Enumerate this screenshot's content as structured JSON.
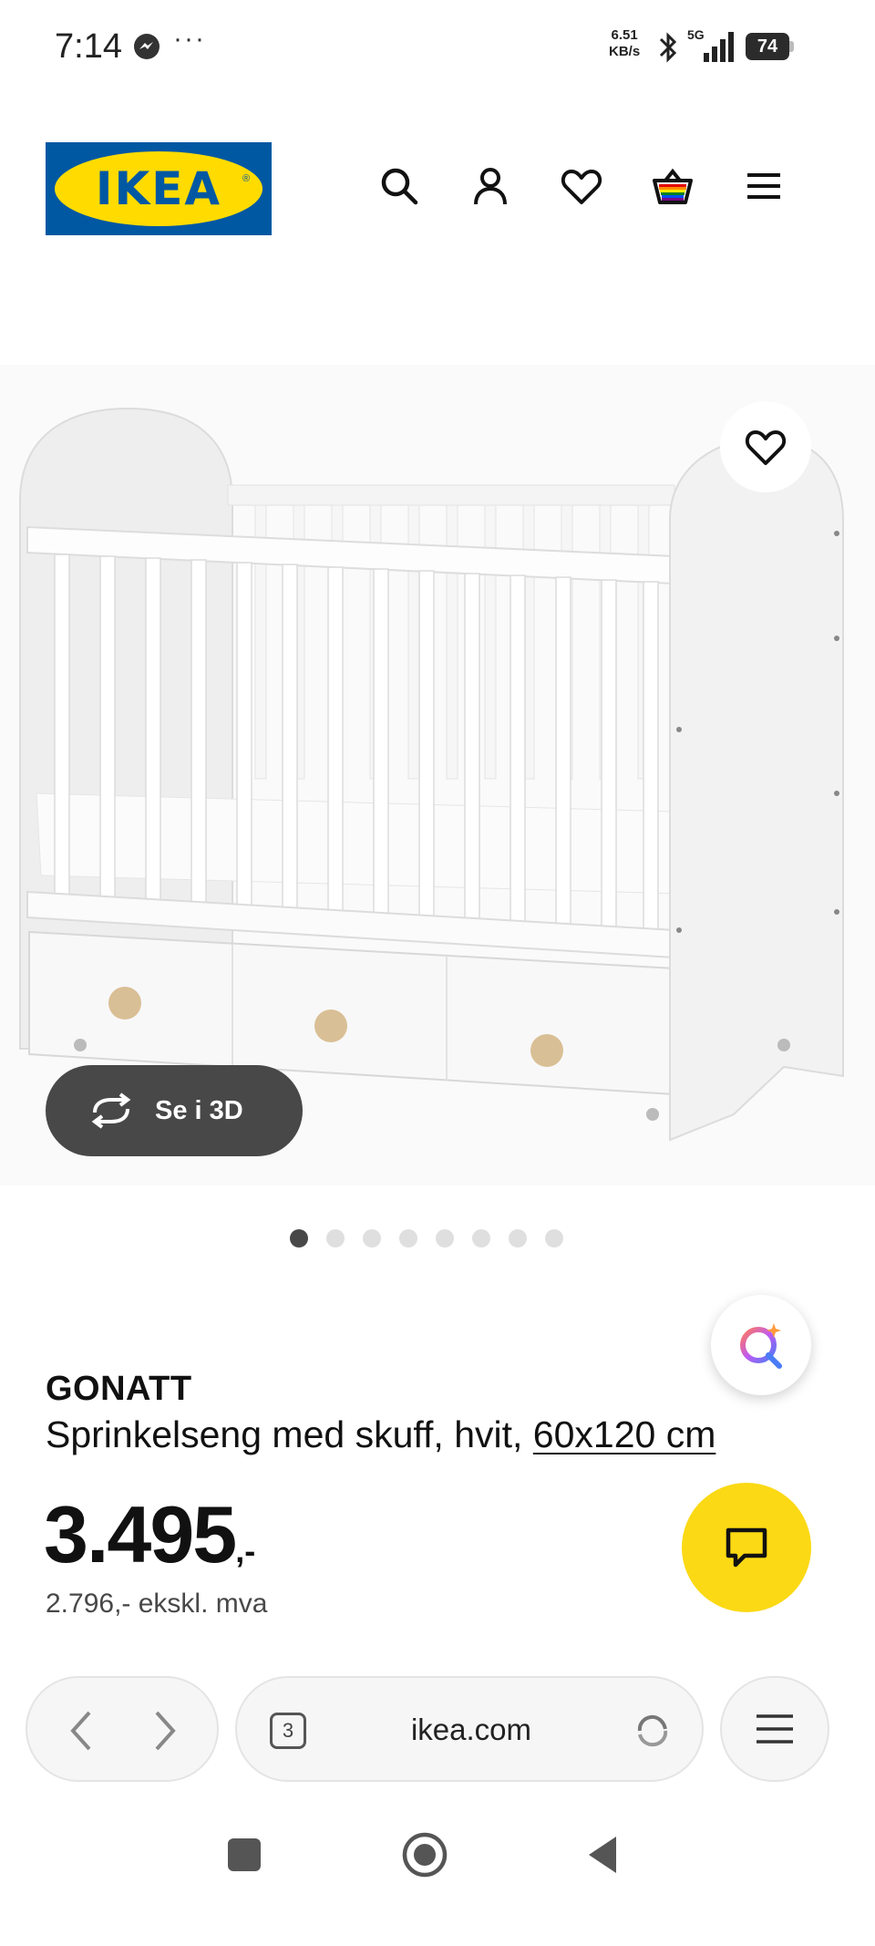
{
  "status_bar": {
    "time": "7:14",
    "more": "···",
    "net_speed_value": "6.51",
    "net_speed_unit": "KB/s",
    "network": "5G",
    "battery": "74"
  },
  "header": {
    "logo_text": "IKEA",
    "icons": [
      "search-icon",
      "account-icon",
      "favourites-icon",
      "basket-icon",
      "menu-icon"
    ],
    "brand_colors": {
      "blue": "#0058a3",
      "yellow": "#ffdb00"
    }
  },
  "product": {
    "image_count": 8,
    "active_image": 1,
    "view_3d_label": "Se i 3D",
    "name": "GONATT",
    "description": "Sprinkelseng med skuff, hvit,",
    "size_link": "60x120 cm",
    "price_main": "3.495",
    "price_suffix": ",-",
    "price_ex_vat": "2.796,- ekskl. mva"
  },
  "chat": {
    "accent_color": "#fbd914"
  },
  "browser": {
    "tab_count": "3",
    "url": "ikea.com"
  }
}
